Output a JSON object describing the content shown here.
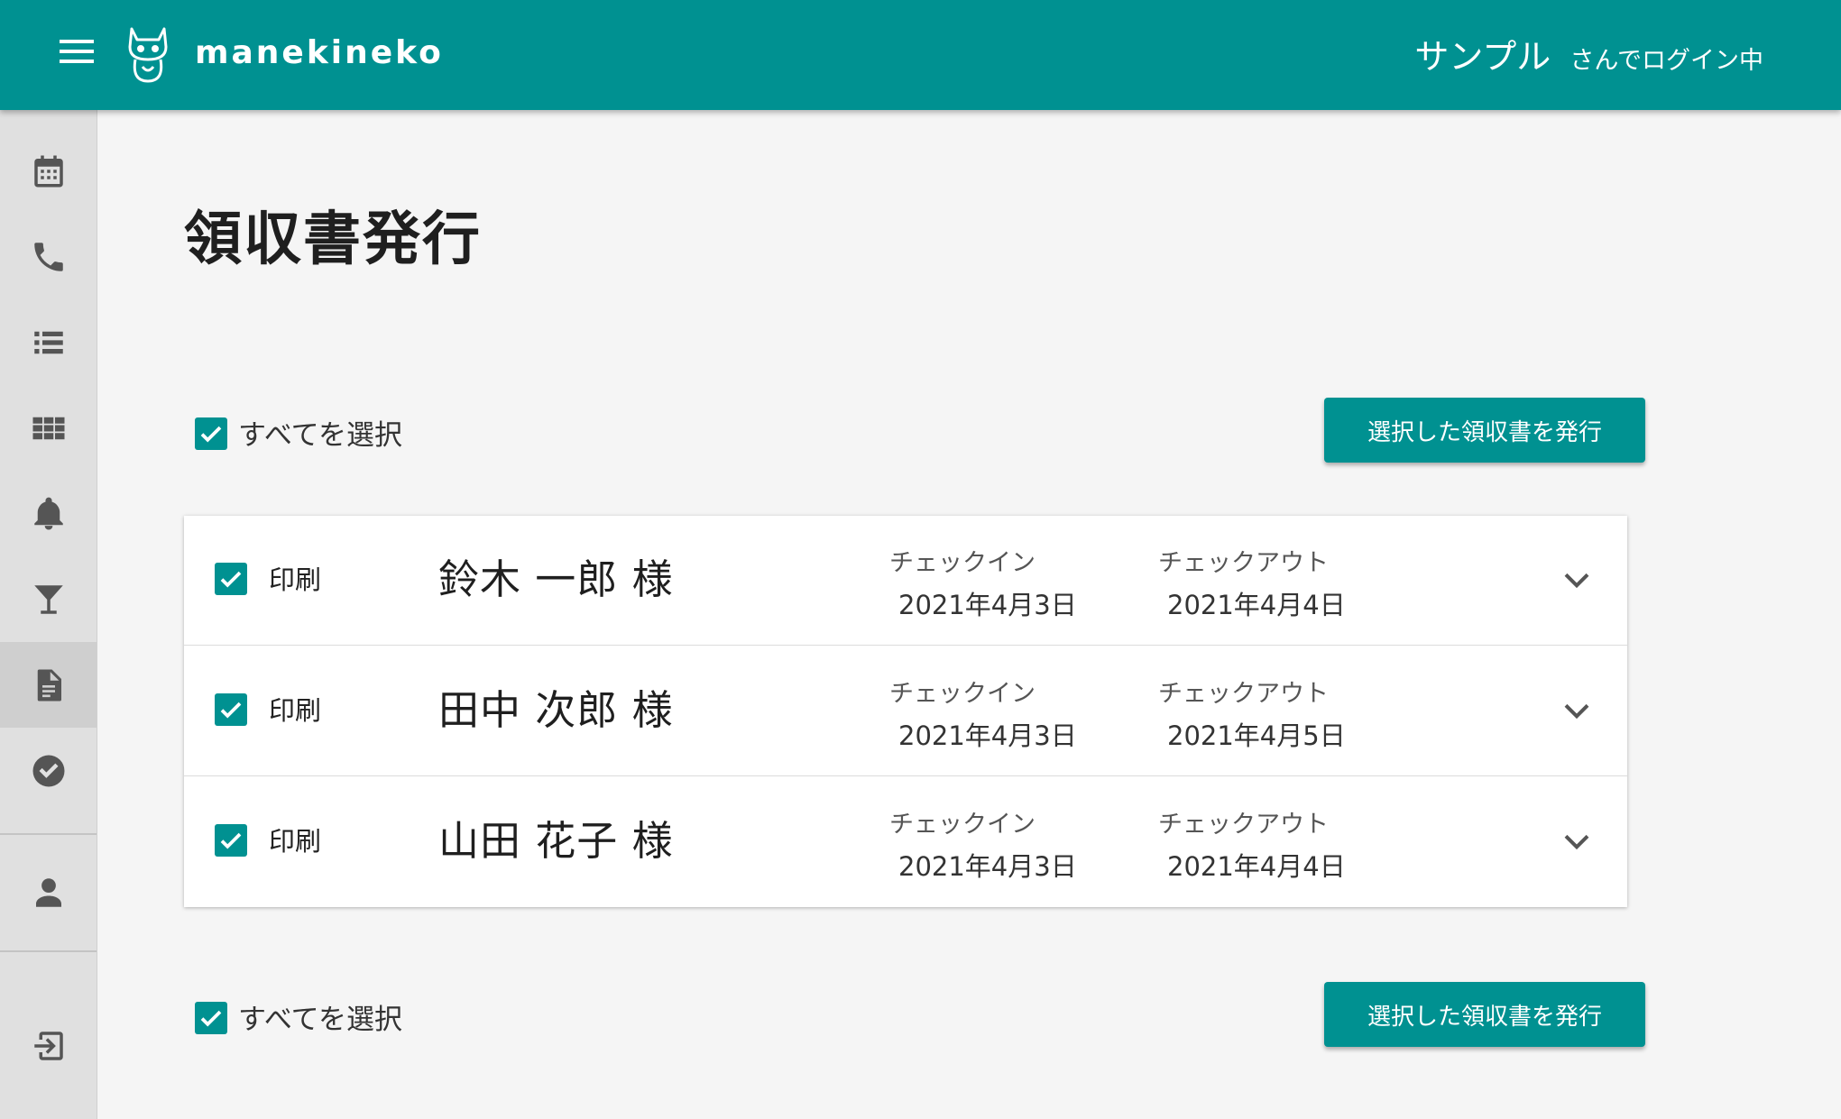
{
  "header": {
    "brand": "manekineko",
    "user_name": "サンプル",
    "login_suffix": "さんでログイン中",
    "color": "#009191"
  },
  "sidebar": {
    "items": [
      {
        "icon": "calendar-icon"
      },
      {
        "icon": "phone-icon"
      },
      {
        "icon": "list-icon"
      },
      {
        "icon": "grid-icon"
      },
      {
        "icon": "bell-icon"
      },
      {
        "icon": "cocktail-icon"
      },
      {
        "icon": "document-icon",
        "active": true
      },
      {
        "icon": "check-circle-icon"
      },
      {
        "icon": "person-icon"
      },
      {
        "icon": "logout-icon"
      }
    ]
  },
  "page": {
    "title": "領収書発行",
    "select_all_label": "すべてを選択",
    "issue_button_label": "選択した領収書を発行"
  },
  "receipts": {
    "checkin_label": "チェックイン",
    "checkout_label": "チェックアウト",
    "print_label": "印刷",
    "rows": [
      {
        "name": "鈴木 一郎 様",
        "checkin": "2021年4月3日",
        "checkout": "2021年4月4日",
        "checked": true
      },
      {
        "name": "田中 次郎 様",
        "checkin": "2021年4月3日",
        "checkout": "2021年4月5日",
        "checked": true
      },
      {
        "name": "山田 花子 様",
        "checkin": "2021年4月3日",
        "checkout": "2021年4月4日",
        "checked": true
      }
    ]
  }
}
